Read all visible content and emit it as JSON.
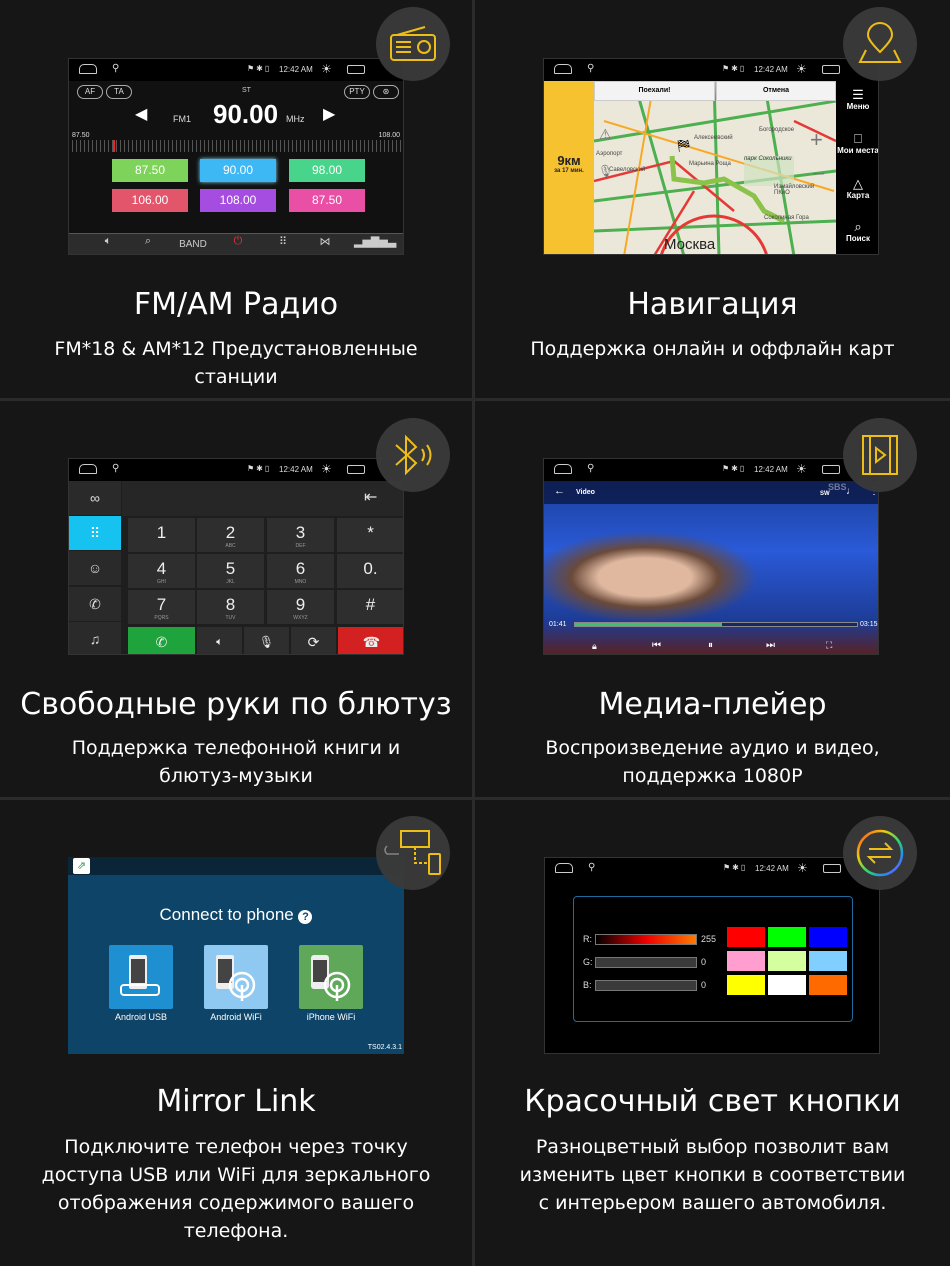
{
  "status_bar": {
    "time": "12:42 AM"
  },
  "radio": {
    "title": "FM/AM Радио",
    "subtitle_lines": [
      "FM*18 & AM*12 Предустановленные",
      "станции"
    ],
    "buttons": {
      "af": "AF",
      "ta": "TA",
      "pty": "PTY"
    },
    "stereo": "ST",
    "band": "FM1",
    "frequency": "90.00",
    "unit": "MHz",
    "scale_min": "87.50",
    "scale_max": "108.00",
    "presets": [
      {
        "label": "87.50",
        "color": "#7ed35a"
      },
      {
        "label": "90.00",
        "color": "#3db8f5"
      },
      {
        "label": "98.00",
        "color": "#48d48a"
      },
      {
        "label": "106.00",
        "color": "#e2556b"
      },
      {
        "label": "108.00",
        "color": "#a54de0"
      },
      {
        "label": "87.50",
        "color": "#ea4fa6"
      }
    ],
    "toolbar": {
      "band": "BAND"
    }
  },
  "navigation": {
    "title": "Навигация",
    "subtitle": "Поддержка онлайн и оффлайн карт",
    "distance": "9км",
    "eta": "за 17 мин.",
    "go": "Поехали!",
    "cancel": "Отмена",
    "menu": [
      "Меню",
      "Мои места",
      "Карта",
      "Поиск"
    ],
    "map_labels": [
      "Москва",
      "парк Сокольники",
      "Богородское",
      "Измайловский ПКиО",
      "Соколиная Гора",
      "Марьина Роща",
      "Аэропорт",
      "Савеловский",
      "Алексеевский"
    ]
  },
  "phone": {
    "title": "Свободные руки по блютуз",
    "subtitle_lines": [
      "Поддержка телефонной книги и",
      "блютуз-музыки"
    ],
    "keys": [
      {
        "d": "1",
        "l": ""
      },
      {
        "d": "2",
        "l": "ABC"
      },
      {
        "d": "3",
        "l": "DEF"
      },
      {
        "d": "*",
        "l": ""
      },
      {
        "d": "4",
        "l": "GHI"
      },
      {
        "d": "5",
        "l": "JKL"
      },
      {
        "d": "6",
        "l": "MNO"
      },
      {
        "d": "0.",
        "l": ""
      },
      {
        "d": "7",
        "l": "PQRS"
      },
      {
        "d": "8",
        "l": "TUV"
      },
      {
        "d": "9",
        "l": "WXYZ"
      },
      {
        "d": "#",
        "l": ""
      }
    ],
    "call_color": "#1fa33c",
    "hangup_color": "#d32020",
    "active_color": "#16c3f0"
  },
  "media": {
    "title": "Медиа-плейер",
    "subtitle_lines": [
      "Воспроизведение аудио и видео,",
      "поддержка 1080P"
    ],
    "header": "Video",
    "channel": "SW",
    "watermark": "SBS",
    "elapsed": "01:41",
    "total": "03:15",
    "progress": 0.52
  },
  "mirror": {
    "title": "Mirror Link",
    "subtitle_lines": [
      "Подключите телефон через точку",
      "доступа USB или WiFi для зеркального",
      "отображения содержимого вашего",
      "телефона."
    ],
    "heading": "Connect to phone",
    "options": [
      {
        "label": "Android USB",
        "color": "#1e8fd0"
      },
      {
        "label": "Android WiFi",
        "color": "#8fc8f0"
      },
      {
        "label": "iPhone WiFi",
        "color": "#5fa85a"
      }
    ],
    "version": "TS02.4.3.1"
  },
  "color_light": {
    "title": "Красочный свет кнопки",
    "subtitle_lines": [
      "Разноцветный выбор позволит вам",
      "изменить цвет кнопки в соответствии",
      "с интерьером вашего автомобиля."
    ],
    "channels": [
      {
        "label": "R:",
        "value": "255"
      },
      {
        "label": "G:",
        "value": "0"
      },
      {
        "label": "B:",
        "value": "0"
      }
    ],
    "swatches": [
      "#ff0000",
      "#00ff00",
      "#0000ff",
      "#ff9ecf",
      "#d5ff9e",
      "#80cfff",
      "#ffff00",
      "#ffffff",
      "#ff6a00"
    ]
  },
  "accent_color": "#f5c518"
}
